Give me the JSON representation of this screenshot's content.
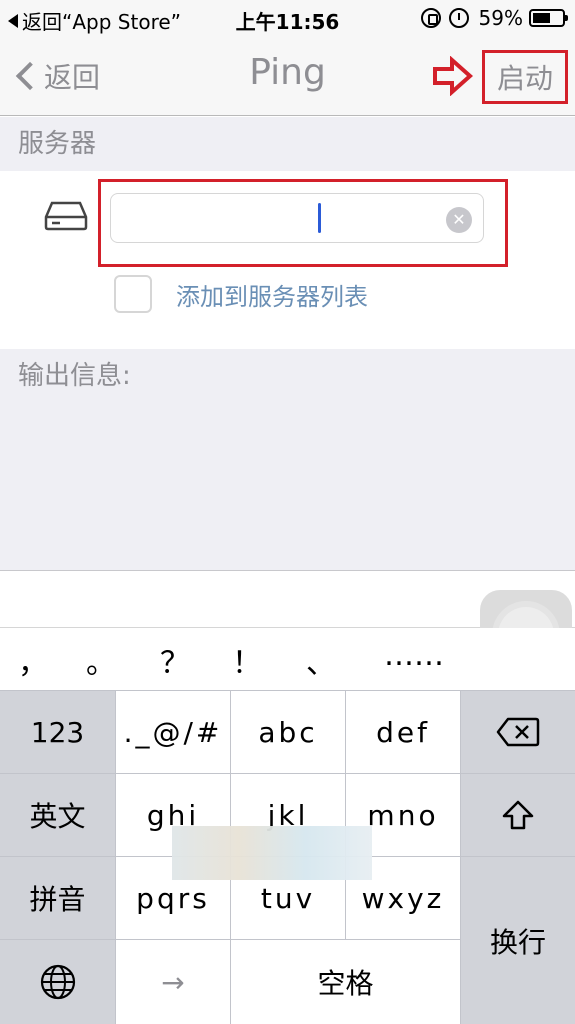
{
  "status_bar": {
    "back_app": "返回“App Store”",
    "time": "上午11:56",
    "battery_percent": "59%",
    "battery_level": 0.59,
    "icons": [
      "lock-rotation-icon",
      "alarm-icon",
      "battery-icon"
    ]
  },
  "nav": {
    "back_label": "返回",
    "title": "Ping",
    "start_label": "启动",
    "highlight_color": "#d3202a"
  },
  "server_section": {
    "header": "服务器",
    "input_value": "",
    "input_placeholder": "",
    "add_to_list_label": "添加到服务器列表",
    "add_to_list_checked": false
  },
  "output_section": {
    "header": "输出信息:",
    "text": ""
  },
  "punctuation_candidates": [
    "，",
    "。",
    "？",
    "！",
    "、",
    "……"
  ],
  "keyboard": {
    "numbers_key": "123",
    "symbols_key": "._@/#",
    "row1": [
      "abc",
      "def"
    ],
    "english_key": "英文",
    "row2": [
      "ghi",
      "jkl",
      "mno"
    ],
    "pinyin_key": "拼音",
    "row3": [
      "pqrs",
      "tuv",
      "wxyz"
    ],
    "enter_key": "换行",
    "arrow_key": "→",
    "space_key": "空格",
    "icons": [
      "delete-icon",
      "shift-icon",
      "globe-icon"
    ]
  }
}
